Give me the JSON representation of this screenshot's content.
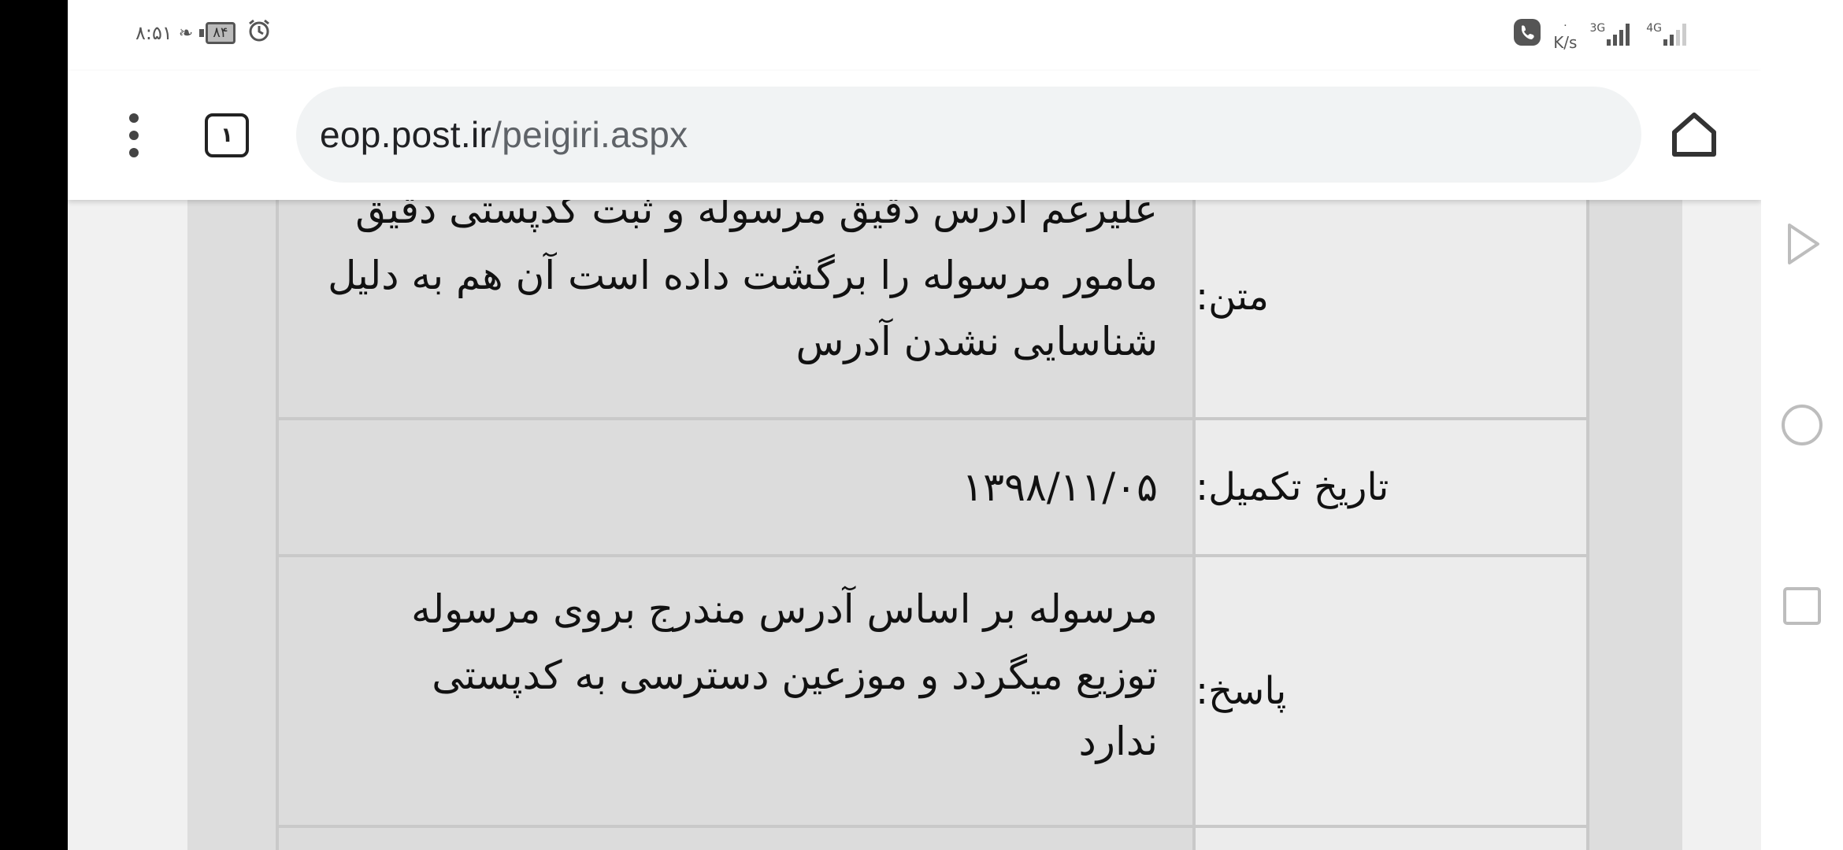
{
  "status_bar": {
    "time": "۸:۵۱",
    "battery": "۸۴",
    "speed_value": "۰",
    "speed_unit": "K/s",
    "network_1": "3G",
    "network_2": "4G"
  },
  "browser": {
    "tab_count": "۱",
    "url_host": "eop.post.ir",
    "url_path": "/peigiri.aspx"
  },
  "table": {
    "rows": [
      {
        "label": "متن:",
        "value": "علیرغم آدرس دقیق مرسوله و ثبت کدپستی دقیق مامور مرسوله را برگشت داده است آن هم به دلیل شناسایی نشدن آدرس"
      },
      {
        "label": "تاریخ تکمیل:",
        "value": "۱۳۹۸/۱۱/۰۵"
      },
      {
        "label": "پاسخ:",
        "value": "مرسوله بر  اساس آدرس مندرج بروی مرسوله توزیع میگردد و موزعین دسترسی به کدپستی ندارد"
      }
    ]
  },
  "icons": {
    "status": [
      "alarm-icon",
      "battery-icon",
      "leaf-icon",
      "phone-icon",
      "signal-icon"
    ],
    "toolbar": [
      "more-vert-icon",
      "tabs-icon",
      "home-icon"
    ],
    "nav": [
      "back-triangle-icon",
      "home-circle-icon",
      "recents-square-icon"
    ]
  }
}
